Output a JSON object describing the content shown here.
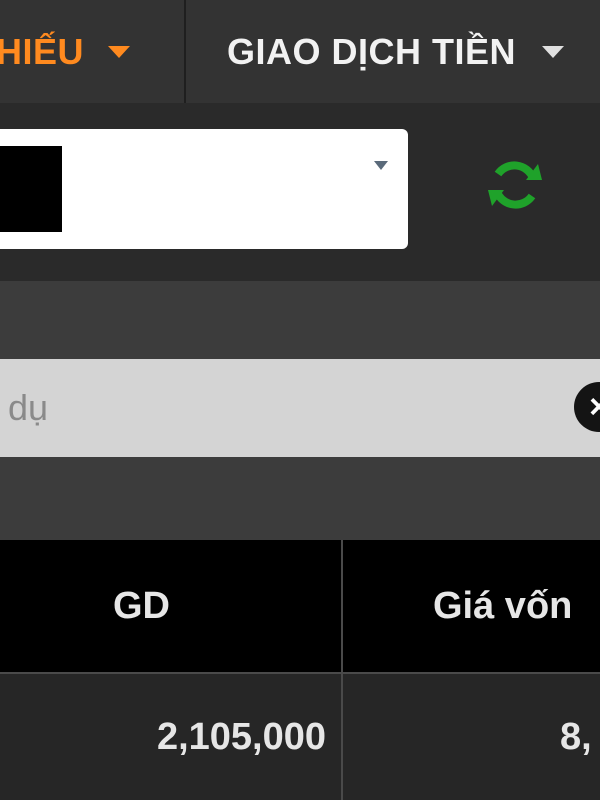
{
  "nav": {
    "tab_stock": "HIẾU",
    "tab_money": "GIAO DỊCH TIỀN",
    "active_color": "#ff8a1f"
  },
  "account": {
    "selected_value": ""
  },
  "search": {
    "placeholder": "í dụ"
  },
  "table": {
    "headers": [
      "GD",
      "Giá vốn"
    ],
    "rows": [
      [
        "2,105,000",
        "8,"
      ]
    ]
  },
  "icons": {
    "refresh": "refresh-icon",
    "clear": "clear-icon",
    "dropdown": "caret-down-icon"
  }
}
